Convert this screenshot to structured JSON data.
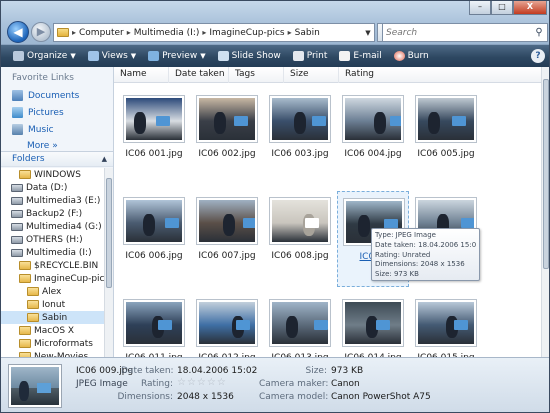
{
  "window": {
    "controls": {
      "minimize": "–",
      "maximize": "□",
      "close": "X"
    }
  },
  "address": {
    "crumbs": [
      "Computer",
      "Multimedia (I:)",
      "ImagineCup-pics",
      "Sabin"
    ],
    "search_placeholder": "Search"
  },
  "toolbar": {
    "items": [
      {
        "label": "Organize",
        "icon": "organize-icon",
        "dropdown": true
      },
      {
        "label": "Views",
        "icon": "views-icon",
        "dropdown": true
      },
      {
        "label": "Preview",
        "icon": "preview-icon",
        "dropdown": true
      },
      {
        "label": "Slide Show",
        "icon": "slideshow-icon",
        "dropdown": false
      },
      {
        "label": "Print",
        "icon": "print-icon",
        "dropdown": false
      },
      {
        "label": "E-mail",
        "icon": "email-icon",
        "dropdown": false
      },
      {
        "label": "Burn",
        "icon": "burn-icon",
        "dropdown": false
      }
    ]
  },
  "sidebar": {
    "favorites_title": "Favorite Links",
    "favorites": [
      {
        "label": "Documents",
        "icon": "documents-icon"
      },
      {
        "label": "Pictures",
        "icon": "pictures-icon"
      },
      {
        "label": "Music",
        "icon": "music-icon"
      }
    ],
    "more_label": "More",
    "folders_label": "Folders",
    "tree": [
      {
        "label": "WINDOWS",
        "depth": 2,
        "type": "folder"
      },
      {
        "label": "Data (D:)",
        "depth": 1,
        "type": "drive"
      },
      {
        "label": "Multimedia3 (E:)",
        "depth": 1,
        "type": "drive"
      },
      {
        "label": "Backup2 (F:)",
        "depth": 1,
        "type": "drive"
      },
      {
        "label": "Multimedia4 (G:)",
        "depth": 1,
        "type": "drive"
      },
      {
        "label": "OTHERS (H:)",
        "depth": 1,
        "type": "drive"
      },
      {
        "label": "Multimedia (I:)",
        "depth": 1,
        "type": "drive"
      },
      {
        "label": "$RECYCLE.BIN",
        "depth": 2,
        "type": "folder"
      },
      {
        "label": "ImagineCup-pics",
        "depth": 2,
        "type": "folder"
      },
      {
        "label": "Alex",
        "depth": 3,
        "type": "folder"
      },
      {
        "label": "Ionut",
        "depth": 3,
        "type": "folder"
      },
      {
        "label": "Sabin",
        "depth": 3,
        "type": "folder",
        "selected": true
      },
      {
        "label": "MacOS X",
        "depth": 2,
        "type": "folder"
      },
      {
        "label": "Microformats",
        "depth": 2,
        "type": "folder"
      },
      {
        "label": "New-Movies",
        "depth": 2,
        "type": "folder"
      }
    ]
  },
  "columns": [
    "Name",
    "Date taken",
    "Tags",
    "Size",
    "Rating"
  ],
  "files": [
    "IC06 001.jpg",
    "IC06 002.jpg",
    "IC06 003.jpg",
    "IC06 004.jpg",
    "IC06 005.jpg",
    "IC06 006.jpg",
    "IC06 007.jpg",
    "IC06 008.jpg",
    "IC06 009.jpg",
    "IC06 010.jpg",
    "IC06 011.jpg",
    "IC06 012.jpg",
    "IC06 013.jpg",
    "IC06 014.jpg",
    "IC06 015.jpg"
  ],
  "selected_label": "IC06 0",
  "tooltip": {
    "type": "Type: JPEG Image",
    "date": "Date taken: 18.04.2006 15:02",
    "rating": "Rating: Unrated",
    "dimensions": "Dimensions: 2048 x 1536",
    "size": "Size: 973 KB"
  },
  "details": {
    "filename": "IC06 009.jpg",
    "filetype": "JPEG Image",
    "date_label": "Date taken:",
    "date_value": "18.04.2006 15:02",
    "rating_label": "Rating:",
    "stars": "☆☆☆☆☆",
    "dim_label": "Dimensions:",
    "dim_value": "2048 x 1536",
    "size_label": "Size:",
    "size_value": "973 KB",
    "maker_label": "Camera maker:",
    "maker_value": "Canon",
    "model_label": "Camera model:",
    "model_value": "Canon PowerShot A75"
  }
}
